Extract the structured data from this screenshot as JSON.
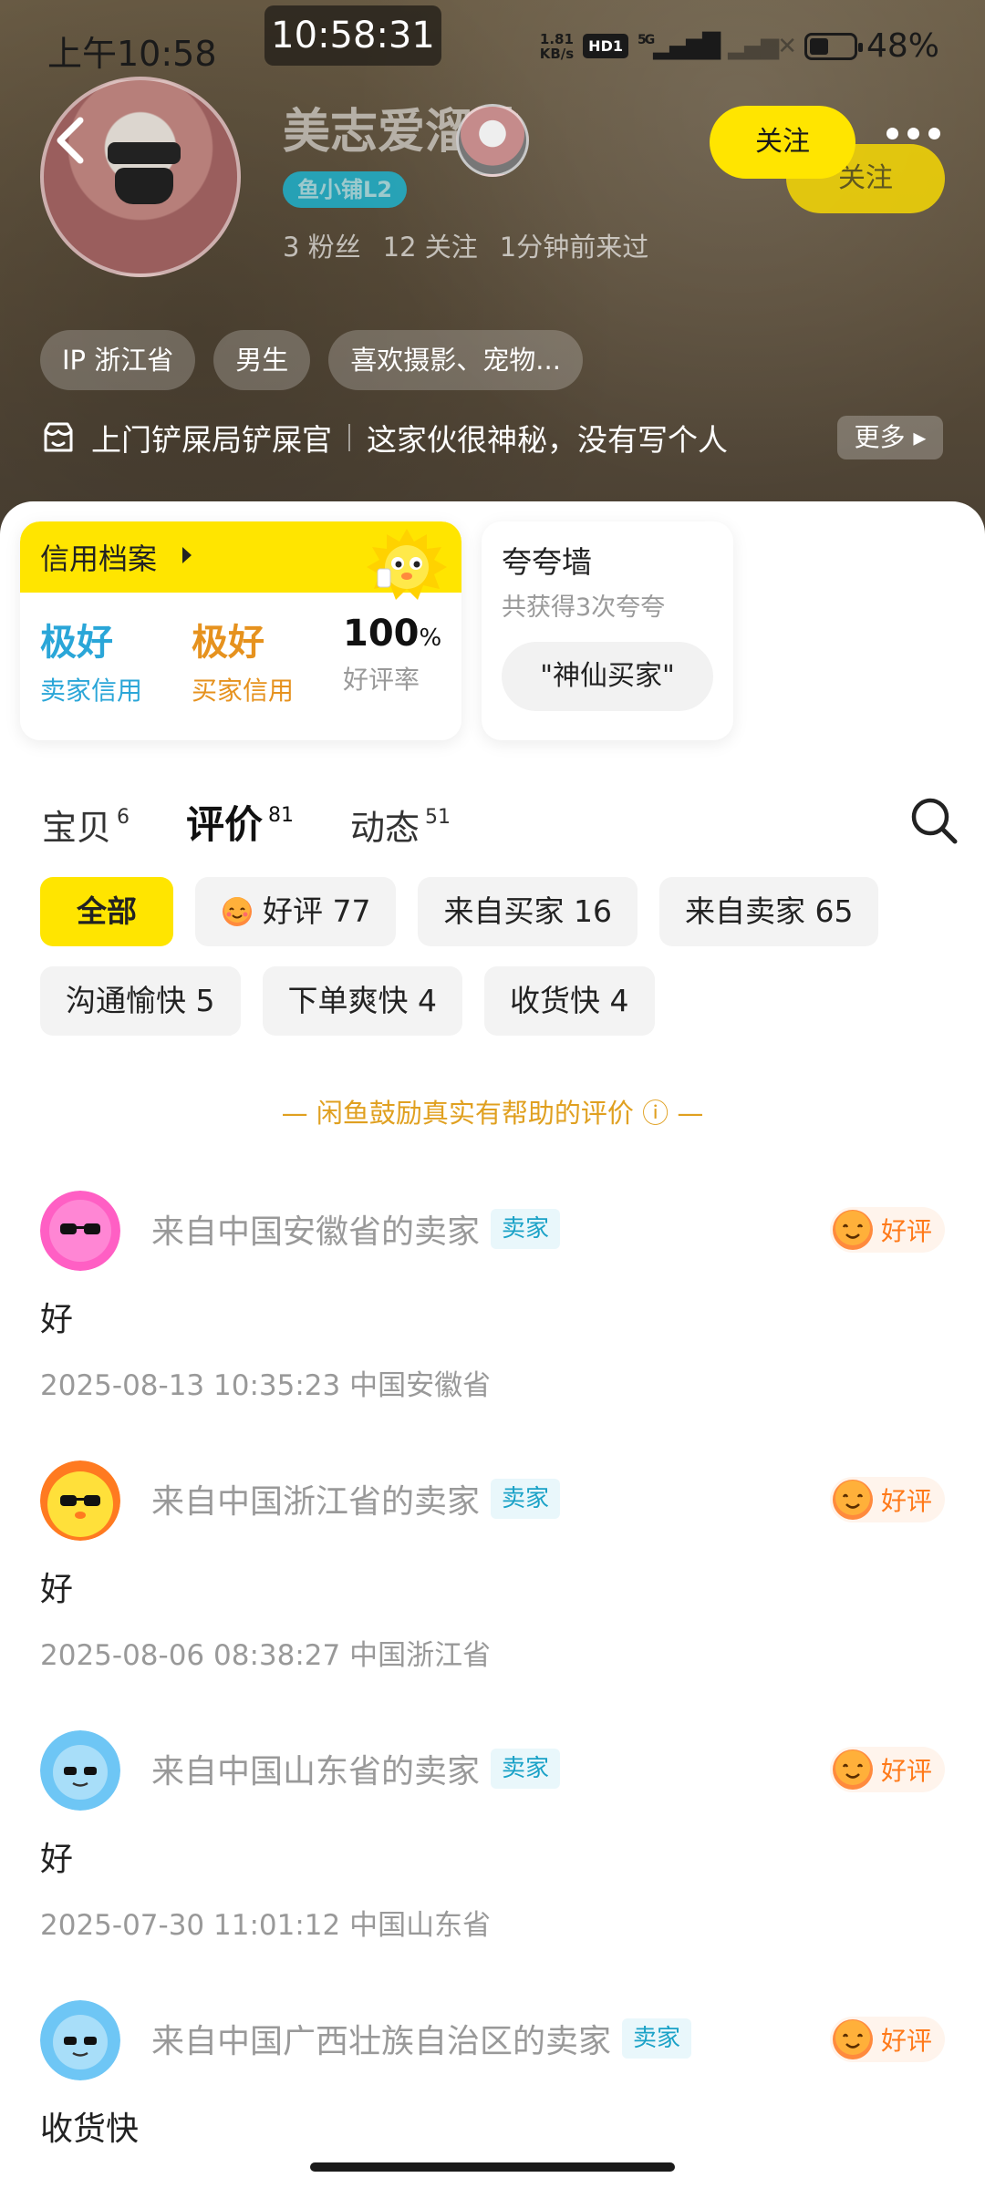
{
  "status_bar": {
    "time": "上午10:58",
    "clock": "10:58:31",
    "net_speed_value": "1.81",
    "net_speed_unit": "KB/s",
    "hd": "HD1",
    "signal": "5G",
    "battery": "48%"
  },
  "profile": {
    "username": "美志爱溜猫",
    "level": "鱼小铺L2",
    "fans": "3 粉丝",
    "following": "12 关注",
    "last_seen": "1分钟前来过",
    "follow_label": "关注",
    "follow_ghost_label": "关注",
    "tags": [
      "IP 浙江省",
      "男生",
      "喜欢摄影、宠物..."
    ],
    "shop_name": "上门铲屎局铲屎官",
    "bio": "这家伙很神秘，没有写个人",
    "more_label": "更多"
  },
  "credit": {
    "title": "信用档案",
    "seller_value": "极好",
    "seller_label": "卖家信用",
    "buyer_value": "极好",
    "buyer_label": "买家信用",
    "rate_value": "100",
    "rate_unit": "%",
    "rate_label": "好评率",
    "colors": {
      "seller": "#2aa6d8",
      "buyer": "#e6921e",
      "rate": "#111111"
    }
  },
  "praise": {
    "title": "夸夸墙",
    "subtitle": "共获得3次夸夸",
    "pill": "\"神仙买家\""
  },
  "tabs": [
    {
      "label": "宝贝",
      "count": "6"
    },
    {
      "label": "评价",
      "count": "81"
    },
    {
      "label": "动态",
      "count": "51"
    }
  ],
  "filters": [
    {
      "label": "全部"
    },
    {
      "label": "好评 77"
    },
    {
      "label": "来自买家 16"
    },
    {
      "label": "来自卖家 65"
    },
    {
      "label": "沟通愉快 5"
    },
    {
      "label": "下单爽快 4"
    },
    {
      "label": "收货快 4"
    }
  ],
  "notice": "— 闲鱼鼓励真实有帮助的评价 ⓘ —",
  "reviews": [
    {
      "from": "来自中国安徽省的卖家",
      "role": "卖家",
      "rating": "好评",
      "text": "好",
      "date": "2025-08-13 10:35:23",
      "location": "中国安徽省"
    },
    {
      "from": "来自中国浙江省的卖家",
      "role": "卖家",
      "rating": "好评",
      "text": "好",
      "date": "2025-08-06 08:38:27",
      "location": "中国浙江省"
    },
    {
      "from": "来自中国山东省的卖家",
      "role": "卖家",
      "rating": "好评",
      "text": "好",
      "date": "2025-07-30 11:01:12",
      "location": "中国山东省"
    },
    {
      "from": "来自中国广西壮族自治区的卖家",
      "role": "卖家",
      "rating": "好评",
      "text": "收货快",
      "date": "",
      "location": ""
    }
  ],
  "accent": "#ffe500"
}
